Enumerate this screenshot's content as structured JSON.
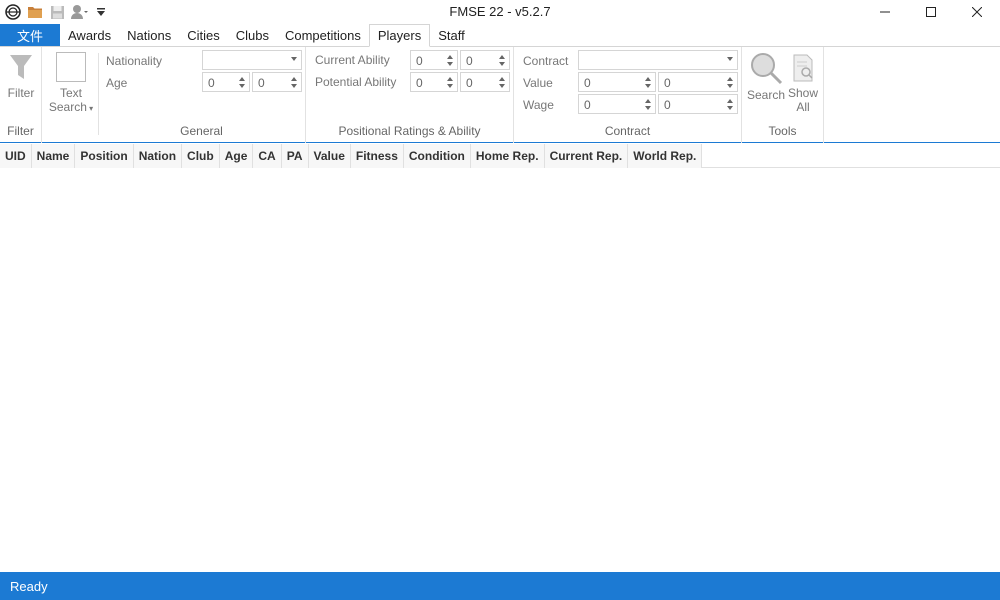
{
  "window": {
    "title": "FMSE 22 - v5.2.7"
  },
  "quick_access": [
    "app-logo-icon",
    "open-folder-icon",
    "save-icon",
    "person-icon",
    "customize-dropdown-icon"
  ],
  "tabs": [
    {
      "label": "文件",
      "active": false
    },
    {
      "label": "Awards",
      "active": false
    },
    {
      "label": "Nations",
      "active": false
    },
    {
      "label": "Cities",
      "active": false
    },
    {
      "label": "Clubs",
      "active": false
    },
    {
      "label": "Competitions",
      "active": false
    },
    {
      "label": "Players",
      "active": true
    },
    {
      "label": "Staff",
      "active": false
    }
  ],
  "ribbon": {
    "filter": {
      "button_label": "Filter",
      "group_label": "Filter"
    },
    "general": {
      "text_search_label": "Text",
      "text_search_label2": "Search",
      "nationality_label": "Nationality",
      "nationality_value": "",
      "age_label": "Age",
      "age_min": "0",
      "age_max": "0",
      "group_label": "General"
    },
    "positional": {
      "current_ability_label": "Current Ability",
      "ca_min": "0",
      "ca_max": "0",
      "potential_ability_label": "Potential Ability",
      "pa_min": "0",
      "pa_max": "0",
      "group_label": "Positional Ratings & Ability"
    },
    "contract": {
      "contract_label": "Contract",
      "contract_value": "",
      "value_label": "Value",
      "value_min": "0",
      "value_max": "0",
      "wage_label": "Wage",
      "wage_min": "0",
      "wage_max": "0",
      "group_label": "Contract"
    },
    "tools": {
      "search_label": "Search",
      "show_all_label": "Show",
      "show_all_label2": "All",
      "group_label": "Tools"
    }
  },
  "grid": {
    "columns": [
      "UID",
      "Name",
      "Position",
      "Nation",
      "Club",
      "Age",
      "CA",
      "PA",
      "Value",
      "Fitness",
      "Condition",
      "Home Rep.",
      "Current Rep.",
      "World Rep."
    ]
  },
  "status": {
    "text": "Ready"
  },
  "colors": {
    "accent": "#1c7ad3"
  }
}
